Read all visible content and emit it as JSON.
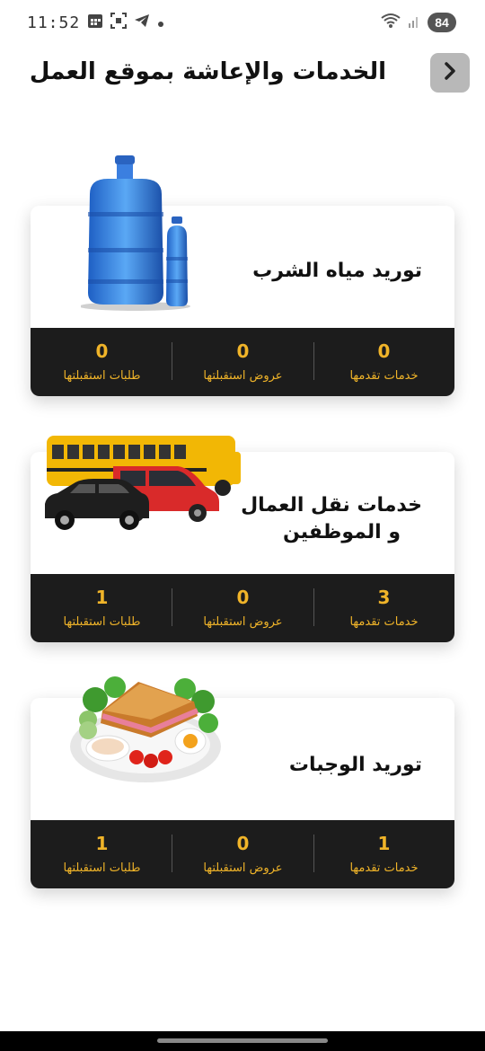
{
  "status_bar": {
    "time": "11:52",
    "battery": "84"
  },
  "header": {
    "title": "الخدمات والإعاشة بموقع العمل"
  },
  "labels": {
    "services_offered": "خدمات تقدمها",
    "offers_received": "عروض استقبلتها",
    "requests_received": "طلبات استقبلتها"
  },
  "cards": [
    {
      "title": "توريد مياه الشرب",
      "services_offered": "0",
      "offers_received": "0",
      "requests_received": "0"
    },
    {
      "title_line1": "خدمات نقل العمال",
      "title_line2": "و الموظفين",
      "services_offered": "3",
      "offers_received": "0",
      "requests_received": "1"
    },
    {
      "title": "توريد الوجبات",
      "services_offered": "1",
      "offers_received": "0",
      "requests_received": "1"
    }
  ],
  "colors": {
    "accent": "#f0b429",
    "dark": "#1c1c1c"
  }
}
